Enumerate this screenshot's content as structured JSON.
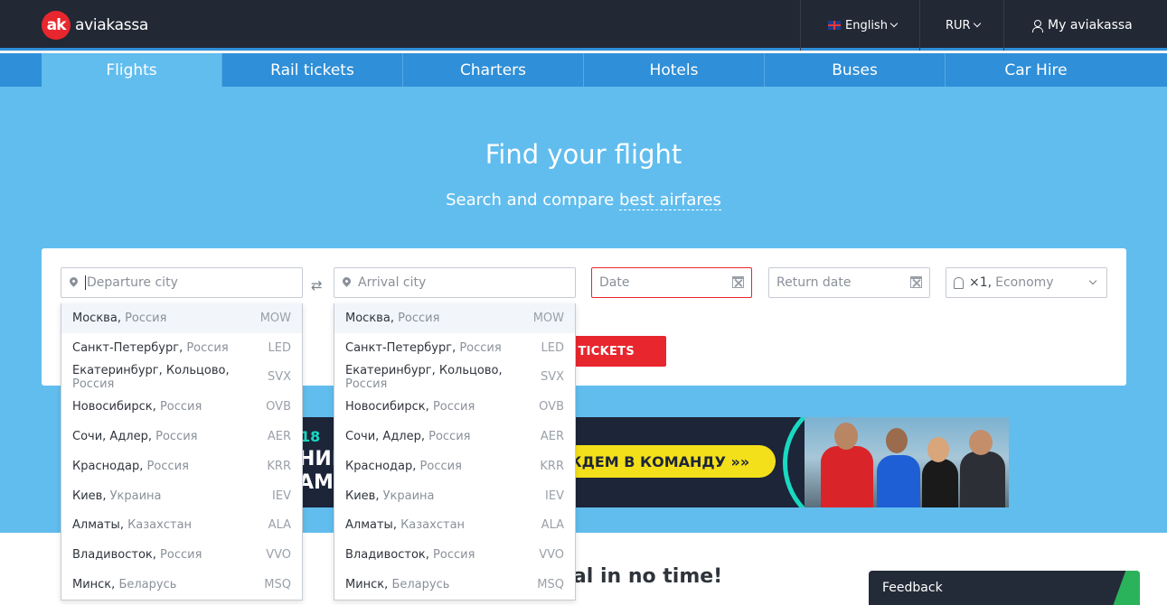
{
  "header": {
    "logo_mark": "ak",
    "logo_text": "aviakassa",
    "language": "English",
    "currency": "RUR",
    "account": "My aviakassa"
  },
  "tabs": [
    {
      "label": "Flights",
      "active": true
    },
    {
      "label": "Rail tickets"
    },
    {
      "label": "Charters"
    },
    {
      "label": "Hotels"
    },
    {
      "label": "Buses"
    },
    {
      "label": "Car Hire"
    }
  ],
  "hero": {
    "title": "Find your flight",
    "subtitle_prefix": "Search and compare ",
    "subtitle_link": "best airfares"
  },
  "search": {
    "departure_placeholder": "Departure city",
    "arrival_placeholder": "Arrival city",
    "date_placeholder": "Date",
    "return_placeholder": "Return date",
    "passengers_count": "×1,",
    "passengers_class": "Economy",
    "button_label": "H TICKETS"
  },
  "banner": {
    "line1": "18",
    "line2": "НИЕ",
    "line3": "АМ",
    "cta": "ЖДЕМ В КОМАНДУ »»"
  },
  "lower": {
    "heading_fragment": "eal in no time!"
  },
  "cities": [
    {
      "city": "Москва",
      "country": "Россия",
      "code": "MOW"
    },
    {
      "city": "Санкт-Петербург",
      "country": "Россия",
      "code": "LED"
    },
    {
      "city": "Екатеринбург, Кольцово",
      "country": "Россия",
      "code": "SVX"
    },
    {
      "city": "Новосибирск",
      "country": "Россия",
      "code": "OVB"
    },
    {
      "city": "Сочи, Адлер",
      "country": "Россия",
      "code": "AER"
    },
    {
      "city": "Краснодар",
      "country": "Россия",
      "code": "KRR"
    },
    {
      "city": "Киев",
      "country": "Украина",
      "code": "IEV"
    },
    {
      "city": "Алматы",
      "country": "Казахстан",
      "code": "ALA"
    },
    {
      "city": "Владивосток",
      "country": "Россия",
      "code": "VVO"
    },
    {
      "city": "Минск",
      "country": "Беларусь",
      "code": "MSQ"
    }
  ],
  "feedback": {
    "label": "Feedback"
  },
  "colors": {
    "brand_red": "#e8262e",
    "tab_blue": "#2f8fd8",
    "hero_blue": "#61bdee",
    "header_dark": "#222834"
  }
}
